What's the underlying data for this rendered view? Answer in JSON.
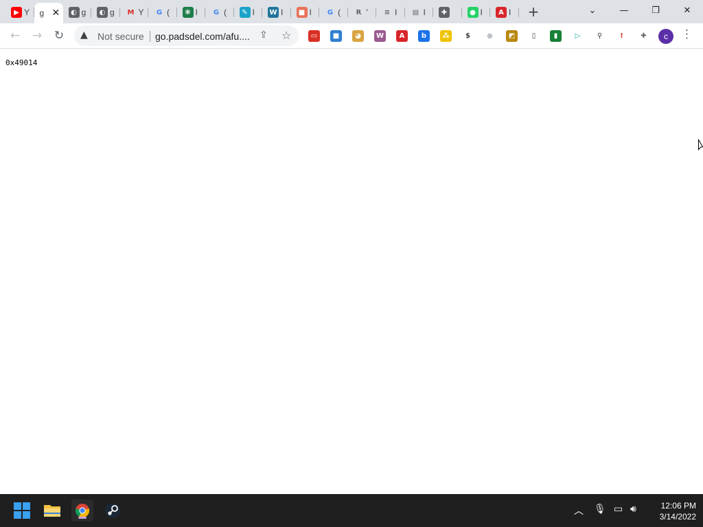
{
  "browser": {
    "tabs": [
      {
        "title": "Y",
        "favicon": "youtube-icon",
        "color": "#ff0000",
        "glyph": "▶"
      },
      {
        "title": "g",
        "favicon": "page-icon",
        "active": true
      },
      {
        "title": "g",
        "favicon": "globe-icon",
        "color": "#5f6368",
        "glyph": "◐"
      },
      {
        "title": "g",
        "favicon": "globe-icon",
        "color": "#5f6368",
        "glyph": "◐"
      },
      {
        "title": "Y",
        "favicon": "gmail-icon",
        "color": "#ffffff",
        "glyph": "M"
      },
      {
        "title": "(",
        "favicon": "google-icon",
        "color": "#ffffff",
        "glyph": "G"
      },
      {
        "title": "I",
        "favicon": "leaf-icon",
        "color": "#1e7e4a",
        "glyph": "❋"
      },
      {
        "title": "(",
        "favicon": "google-icon",
        "color": "#ffffff",
        "glyph": "G"
      },
      {
        "title": "I",
        "favicon": "sketch-icon",
        "color": "#1aa3c9",
        "glyph": "✎"
      },
      {
        "title": "I",
        "favicon": "wordpress-icon",
        "color": "#21759b",
        "glyph": "W"
      },
      {
        "title": "I",
        "favicon": "image-icon",
        "color": "#e8735a",
        "glyph": "■"
      },
      {
        "title": "(",
        "favicon": "google-icon",
        "color": "#ffffff",
        "glyph": "G"
      },
      {
        "title": "'",
        "favicon": "r-icon",
        "color": "#ffffff",
        "glyph": "R"
      },
      {
        "title": "I",
        "favicon": "flag-icon",
        "color": "#7ec8e3",
        "glyph": "≡"
      },
      {
        "title": "I",
        "favicon": "doc-icon",
        "color": "#a8c7fa",
        "glyph": "▤"
      },
      {
        "title": "",
        "favicon": "puzzle-icon",
        "color": "#5f6368",
        "glyph": "✚"
      },
      {
        "title": "I",
        "favicon": "chat-icon",
        "color": "#25d366",
        "glyph": "●"
      },
      {
        "title": "I",
        "favicon": "ask-icon",
        "color": "#d9252a",
        "glyph": "A"
      }
    ],
    "new_tab_label": "+",
    "window_controls": {
      "tab_search": "⌄",
      "minimize": "—",
      "restore": "❐",
      "close": "✕"
    }
  },
  "toolbar": {
    "back": "←",
    "forward": "→",
    "reload": "↻",
    "security_warning_glyph": "▲",
    "security_text": "Not secure",
    "url": "go.padsdel.com/afu....",
    "share_glyph": "⇪",
    "bookmark_glyph": "☆",
    "extensions": [
      {
        "name": "ext-red-icon",
        "color": "#d93025",
        "glyph": "▭"
      },
      {
        "name": "ext-square-icon",
        "color": "#2f7fd1",
        "glyph": "■"
      },
      {
        "name": "ext-doge-icon",
        "color": "#d9a441",
        "glyph": "◕"
      },
      {
        "name": "ext-woocommerce-icon",
        "color": "#9b5c8f",
        "glyph": "W"
      },
      {
        "name": "ext-ask-icon",
        "color": "#d9252a",
        "glyph": "A"
      },
      {
        "name": "ext-b-icon",
        "color": "#1a73e8",
        "glyph": "b"
      },
      {
        "name": "ext-grid-icon",
        "color": "#f0c300",
        "glyph": "⁂"
      },
      {
        "name": "ext-dollar-icon",
        "color": "#ffffff",
        "glyph": "$"
      },
      {
        "name": "ext-moon-icon",
        "color": "#dadce0",
        "glyph": "●"
      },
      {
        "name": "ext-box-icon",
        "color": "#b8860b",
        "glyph": "◩"
      },
      {
        "name": "ext-page-icon",
        "color": "#ffffff",
        "glyph": "▯"
      },
      {
        "name": "ext-green-icon",
        "color": "#188038",
        "glyph": "▮"
      },
      {
        "name": "ext-play-icon",
        "color": "#ffffff",
        "glyph": "▷"
      },
      {
        "name": "ext-magnifier-icon",
        "color": "#ffffff",
        "glyph": "⚲"
      },
      {
        "name": "ext-exclaim-icon",
        "color": "#ffffff",
        "glyph": "!"
      },
      {
        "name": "extensions-puzzle-icon",
        "color": "#ffffff",
        "glyph": "✚"
      }
    ],
    "profile_initial": "c",
    "menu_glyph": "⋮"
  },
  "page": {
    "content": "0x49014"
  },
  "taskbar": {
    "time": "12:06 PM",
    "date": "3/14/2022"
  }
}
